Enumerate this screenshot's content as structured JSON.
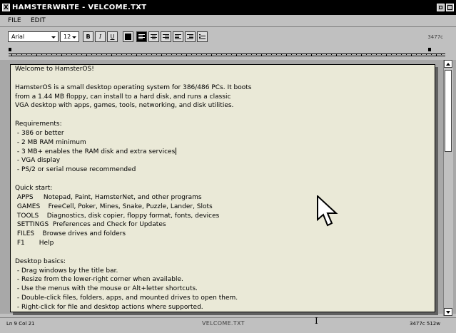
{
  "window": {
    "title": "HAMSTERWRITE - VELCOME.TXT",
    "close_glyph": "X"
  },
  "menu": [
    {
      "label": "FILE"
    },
    {
      "label": "EDIT"
    }
  ],
  "toolbar": {
    "font_value": "Arial",
    "size_value": "12",
    "bold_label": "B",
    "italic_label": "I",
    "underline_label": "U",
    "text_color": "#000000",
    "alignment_selected": "left",
    "word_count_top": "3477c"
  },
  "document": {
    "lines": [
      "Welcome to HamsterOS!",
      "",
      "HamsterOS is a small desktop operating system for 386/486 PCs. It boots",
      "from a 1.44 MB floppy, can install to a hard disk, and runs a classic",
      "VGA desktop with apps, games, tools, networking, and disk utilities.",
      "",
      "Requirements:",
      " - 386 or better",
      " - 2 MB RAM minimum",
      " - 3 MB+ enables the RAM disk and extra services",
      " - VGA display",
      " - PS/2 or serial mouse recommended",
      "",
      "Quick start:",
      " APPS     Notepad, Paint, HamsterNet, and other programs",
      " GAMES    FreeCell, Poker, Mines, Snake, Puzzle, Lander, Slots",
      " TOOLS    Diagnostics, disk copier, floppy format, fonts, devices",
      " SETTINGS  Preferences and Check for Updates",
      " FILES    Browse drives and folders",
      " F1       Help",
      "",
      "Desktop basics:",
      " - Drag windows by the title bar.",
      " - Resize from the lower-right corner when available.",
      " - Use the menus with the mouse or Alt+letter shortcuts.",
      " - Double-click files, folders, apps, and mounted drives to open them.",
      " - Right-click for file and desktop actions where supported."
    ],
    "caret_line": 9
  },
  "status": {
    "position": "Ln 9 Col 21",
    "filename": "VELCOME.TXT",
    "counts": "3477c 512w"
  },
  "icons": {
    "pointer": "arrow-pointer-icon",
    "ibeam": "text-cursor-icon"
  }
}
